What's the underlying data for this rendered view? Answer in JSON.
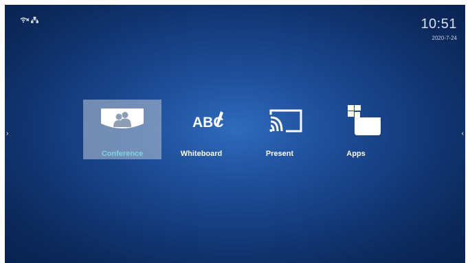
{
  "status": {
    "wifi_icon": "wifi-off-icon",
    "network_icon": "ethernet-icon"
  },
  "clock": {
    "time": "10:51",
    "date": "2020-7-24"
  },
  "menu": {
    "items": [
      {
        "label": "Conference",
        "icon": "people-icon",
        "selected": true
      },
      {
        "label": "Whiteboard",
        "icon": "abc-pen-icon",
        "selected": false
      },
      {
        "label": "Present",
        "icon": "cast-icon",
        "selected": false
      },
      {
        "label": "Apps",
        "icon": "apps-folder-icon",
        "selected": false
      }
    ]
  },
  "nav": {
    "left_arrow": "›",
    "right_arrow": "‹"
  },
  "colors": {
    "background": "#143b7c",
    "selected_tile": "#aab9cd",
    "selected_label": "#7fd3de"
  }
}
